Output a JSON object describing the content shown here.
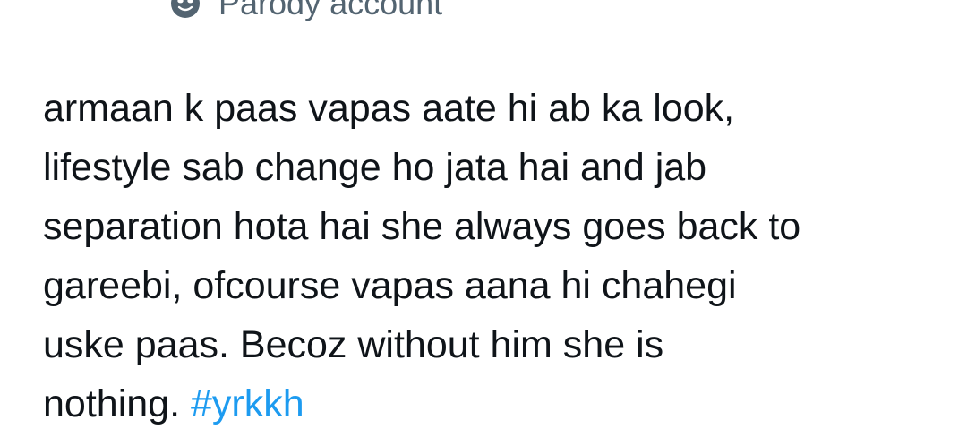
{
  "header": {
    "parody_label": "Parody account",
    "icon": "theater-mask-icon"
  },
  "tweet": {
    "lines": [
      "armaan k paas vapas aate hi ab ka look,",
      "lifestyle sab change ho jata hai and jab",
      "separation hota hai she always goes back to",
      "gareebi, ofcourse vapas aana hi chahegi",
      "uske paas. Becoz without him she is"
    ],
    "last_line_text": "nothing. ",
    "hashtag": "#yrkkh"
  },
  "colors": {
    "text": "#0f1419",
    "secondary": "#536471",
    "link": "#1d9bf0"
  }
}
